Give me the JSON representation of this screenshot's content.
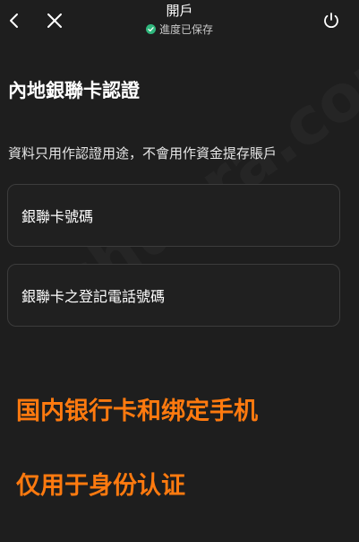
{
  "header": {
    "title": "開戶",
    "status": "進度已保存",
    "icons": {
      "back": "chevron-left-icon",
      "close": "close-icon",
      "power": "power-icon",
      "status": "check-circle-icon"
    },
    "status_color": "#2fb67c"
  },
  "main": {
    "title": "內地銀聯卡認證",
    "subtitle": "資料只用作認證用途，不會用作資金提存賬戶",
    "fields": [
      {
        "placeholder": "銀聯卡號碼"
      },
      {
        "placeholder": "銀聯卡之登記電話號碼"
      }
    ]
  },
  "overlay": {
    "line1": "国内银行卡和绑定手机",
    "line2": "仅用于身份认证",
    "color": "#ff7a0f",
    "watermark": "tchuora.com"
  }
}
